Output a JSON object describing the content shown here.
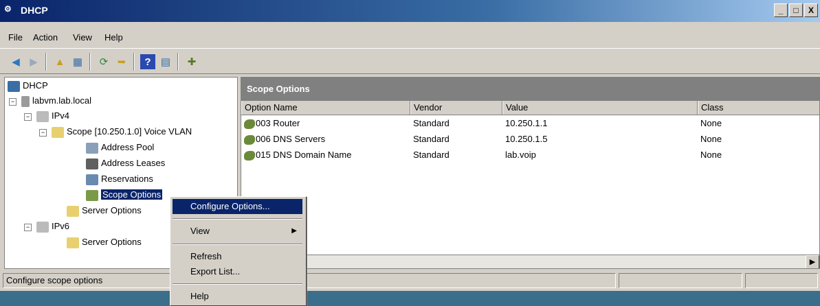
{
  "window": {
    "title": "DHCP",
    "app_icon": "dhcp-icon"
  },
  "title_buttons": [
    "_",
    "□",
    "X"
  ],
  "menu": [
    "File",
    "Action",
    "View",
    "Help"
  ],
  "toolbar": {
    "icons": [
      "back-icon",
      "forward-icon",
      "up-folder-icon",
      "show-hide-tree-icon",
      "refresh-icon",
      "export-list-icon",
      "help-icon",
      "properties-icon",
      "add-server-icon"
    ]
  },
  "tree": {
    "root": "DHCP",
    "server": "labvm.lab.local",
    "ipv4": "IPv4",
    "scope": "Scope [10.250.1.0] Voice VLAN",
    "address_pool": "Address Pool",
    "address_leases": "Address Leases",
    "reservations": "Reservations",
    "scope_options": "Scope Options",
    "server_options_v4": "Server Options",
    "ipv6": "IPv6",
    "server_options_v6": "Server Options"
  },
  "details": {
    "header": "Scope Options",
    "columns": [
      "Option Name",
      "Vendor",
      "Value",
      "Class"
    ],
    "rows": [
      [
        "003 Router",
        "Standard",
        "10.250.1.1",
        "None"
      ],
      [
        "006 DNS Servers",
        "Standard",
        "10.250.1.5",
        "None"
      ],
      [
        "015 DNS Domain Name",
        "Standard",
        "lab.voip",
        "None"
      ]
    ]
  },
  "context_menu": {
    "configure": "Configure Options...",
    "view": "View",
    "refresh": "Refresh",
    "export": "Export List...",
    "help": "Help"
  },
  "status": "Configure scope options",
  "colors": {
    "selection": "#0a246a",
    "face": "#d4d0c8",
    "header": "#808080"
  }
}
